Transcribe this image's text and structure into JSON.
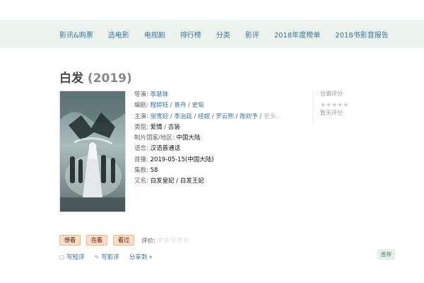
{
  "nav": {
    "items": [
      "影讯&购票",
      "选电影",
      "电视剧",
      "排行榜",
      "分类",
      "影评",
      "2018年度榜单",
      "2018书影音报告"
    ]
  },
  "title": {
    "name": "白发",
    "year": "(2019)"
  },
  "info": {
    "director_label": "导演:",
    "director": "李慧珠",
    "writer_label": "编剧:",
    "writers": [
      "程婷钰",
      "景舟",
      "史韬"
    ],
    "cast_label": "主演:",
    "cast": [
      "张雪迎",
      "李治廷",
      "经超",
      "罗云熙",
      "陈欣予"
    ],
    "cast_more": "更多...",
    "genre_label": "类型:",
    "genres": [
      "爱情",
      "古装"
    ],
    "country_label": "制片国家/地区:",
    "country": "中国大陆",
    "language_label": "语言:",
    "language": "汉语普通话",
    "premiere_label": "首播:",
    "premiere": "2019-05-15(中国大陆)",
    "episodes_label": "集数:",
    "episodes": "58",
    "aka_label": "又名:",
    "aka": "白发皇妃 / 白发王妃"
  },
  "rating": {
    "label": "豆瓣评分",
    "stars": "★★★★★",
    "none": "暂无评分"
  },
  "marks": {
    "want": "想看",
    "doing": "在看",
    "done": "看过",
    "rate_label": "评价:",
    "rate_stars": "☆☆☆☆☆"
  },
  "actions": {
    "short_review": "写短评",
    "review": "写影评",
    "share": "分享到",
    "share_arrow": "▾",
    "short_review_icon": "bubble-icon",
    "review_icon": "pen-icon"
  },
  "recommend": "推荐",
  "colors": {
    "link": "#3377aa",
    "nav_bg": "#edf4ed",
    "button_bg": "#f9dfc8",
    "rec_bg": "#e3f1ed"
  }
}
